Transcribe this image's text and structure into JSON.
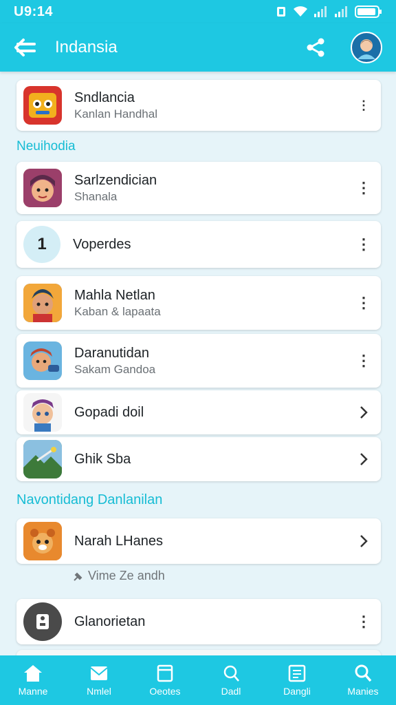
{
  "status_bar": {
    "time": "U9:14"
  },
  "app_bar": {
    "title": "Indansia",
    "icons": [
      "back-arrow-icon",
      "share-icon",
      "avatar"
    ]
  },
  "items_top": [
    {
      "title": "Sndlancia",
      "subtitle": "Kanlan Handhal",
      "icon": "game-tile-icon",
      "trailing": "more"
    }
  ],
  "sections": [
    {
      "header": "Neuihodia",
      "items": [
        {
          "title": "Sarlzendician",
          "subtitle": "Shanala",
          "icon": "character-tile-icon",
          "trailing": "more"
        },
        {
          "title": "Voperdes",
          "subtitle": "",
          "icon": "number-one-icon",
          "badge": "1",
          "trailing": "more"
        },
        {
          "title": "Mahla Netlan",
          "subtitle": "Kaban & lapaata",
          "icon": "character-tile-icon",
          "trailing": "more"
        },
        {
          "title": "Daranutidan",
          "subtitle": "Sakam Gandoa",
          "icon": "character-tile-icon",
          "trailing": "more"
        },
        {
          "title": "Gopadi doil",
          "subtitle": "",
          "icon": "character-tile-icon",
          "trailing": "chevron"
        },
        {
          "title": "Ghik Sba",
          "subtitle": "",
          "icon": "landscape-tile-icon",
          "trailing": "chevron"
        }
      ]
    },
    {
      "header": "Navontidang Danlanilan",
      "items": [
        {
          "title": "Narah LHanes",
          "subtitle": "",
          "icon": "animal-tile-icon",
          "trailing": "chevron"
        }
      ],
      "note": "Vime Ze andh"
    }
  ],
  "items_bottom": [
    {
      "title": "Glanorietan",
      "subtitle": "",
      "icon": "settings-tile-icon",
      "trailing": "more"
    }
  ],
  "bottom_nav": [
    {
      "label": "Manne",
      "icon": "home-icon"
    },
    {
      "label": "Nmlel",
      "icon": "mail-icon"
    },
    {
      "label": "Oeotes",
      "icon": "notes-icon"
    },
    {
      "label": "Dadl",
      "icon": "search-icon"
    },
    {
      "label": "Dangli",
      "icon": "list-icon"
    },
    {
      "label": "Manies",
      "icon": "search-icon"
    }
  ],
  "colors": {
    "accent": "#1ec8e2",
    "header_text": "#16bcd4",
    "background": "#e6f4f9"
  }
}
